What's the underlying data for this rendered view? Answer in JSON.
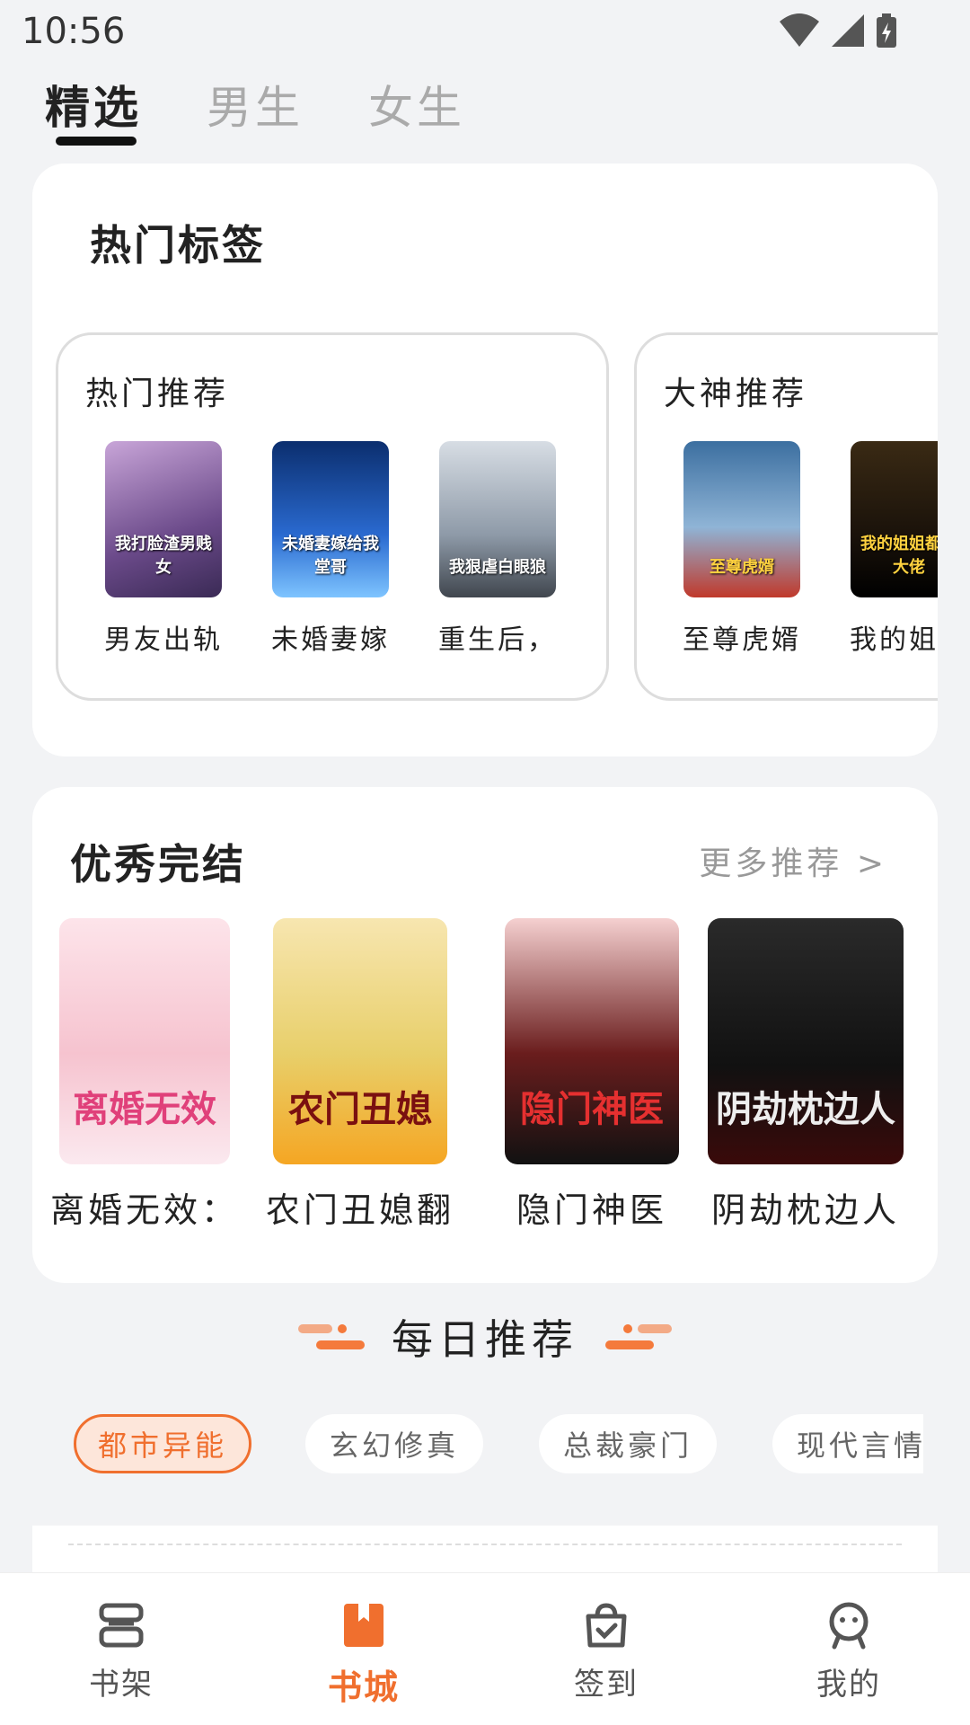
{
  "status": {
    "time": "10:56"
  },
  "top_tabs": [
    {
      "label": "精选",
      "active": true
    },
    {
      "label": "男生",
      "active": false
    },
    {
      "label": "女生",
      "active": false
    }
  ],
  "hot_tags": {
    "title": "热门标签",
    "groups": [
      {
        "title": "热门推荐",
        "books": [
          {
            "name": "男友出轨",
            "cover_text": "我打脸渣男贱女"
          },
          {
            "name": "未婚妻嫁",
            "cover_text": "未婚妻嫁给我堂哥"
          },
          {
            "name": "重生后，",
            "cover_text": "我狠虐白眼狼"
          }
        ]
      },
      {
        "title": "大神推荐",
        "books": [
          {
            "name": "至尊虎婿",
            "cover_text": "至尊虎婿"
          },
          {
            "name": "我的姐妹",
            "cover_text": "我的姐姐都是大佬"
          }
        ]
      }
    ]
  },
  "finished": {
    "title": "优秀完结",
    "more_label": "更多推荐 >",
    "books": [
      {
        "name": "离婚无效：",
        "cover_text": "离婚无效"
      },
      {
        "name": "农门丑媳翻",
        "cover_text": "农门丑媳"
      },
      {
        "name": "隐门神医",
        "cover_text": "隐门神医"
      },
      {
        "name": "阴劫枕边人",
        "cover_text": "阴劫枕边人"
      }
    ]
  },
  "daily": {
    "title": "每日推荐",
    "chips": [
      {
        "label": "都市异能",
        "active": true
      },
      {
        "label": "玄幻修真",
        "active": false
      },
      {
        "label": "总裁豪门",
        "active": false
      },
      {
        "label": "现代言情",
        "active": false
      }
    ]
  },
  "bottom_nav": [
    {
      "label": "书架",
      "icon": "bookshelf-icon",
      "active": false
    },
    {
      "label": "书城",
      "icon": "bookstore-icon",
      "active": true
    },
    {
      "label": "签到",
      "icon": "checkin-icon",
      "active": false
    },
    {
      "label": "我的",
      "icon": "profile-icon",
      "active": false
    }
  ],
  "colors": {
    "accent": "#f06f2e",
    "background": "#f2f3f5"
  }
}
